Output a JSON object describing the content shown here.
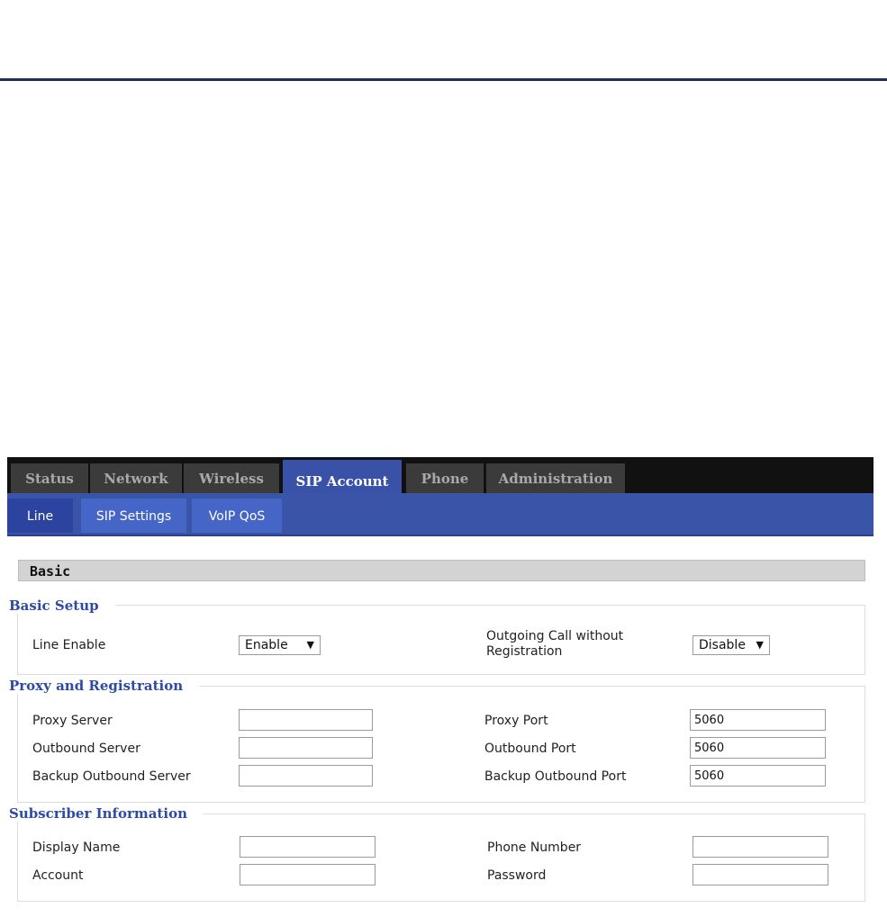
{
  "nav": {
    "tabs": [
      {
        "label": "Status"
      },
      {
        "label": "Network"
      },
      {
        "label": "Wireless"
      },
      {
        "label": "SIP Account"
      },
      {
        "label": "Phone"
      },
      {
        "label": "Administration"
      }
    ],
    "active_tab": "SIP Account"
  },
  "subnav": {
    "tabs": [
      {
        "label": "Line"
      },
      {
        "label": "SIP Settings"
      },
      {
        "label": "VoIP QoS"
      }
    ],
    "active_tab": "Line"
  },
  "section": {
    "title": "Basic"
  },
  "basic_setup": {
    "legend": "Basic Setup",
    "line_enable_label": "Line Enable",
    "line_enable_value": "Enable",
    "outgoing_label_line1": "Outgoing Call without",
    "outgoing_label_line2": "Registration",
    "outgoing_value": "Disable",
    "arrow_icon": "▼"
  },
  "proxy": {
    "legend": "Proxy and Registration",
    "proxy_server_label": "Proxy Server",
    "proxy_server_value": "",
    "outbound_server_label": "Outbound Server",
    "outbound_server_value": "",
    "backup_outbound_server_label": "Backup Outbound Server",
    "backup_outbound_server_value": "",
    "proxy_port_label": "Proxy Port",
    "proxy_port_value": "5060",
    "outbound_port_label": "Outbound Port",
    "outbound_port_value": "5060",
    "backup_outbound_port_label": "Backup Outbound Port",
    "backup_outbound_port_value": "5060"
  },
  "subscriber": {
    "legend": "Subscriber Information",
    "display_name_label": "Display Name",
    "display_name_value": "",
    "account_label": "Account",
    "account_value": "",
    "phone_number_label": "Phone Number",
    "phone_number_value": "",
    "password_label": "Password",
    "password_value": ""
  },
  "colors": {
    "top_bar": "#111111",
    "tab_inactive": "#3b3b3b",
    "tab_active": "#3952a8",
    "sub_bar": "#3a55a8",
    "legend_text": "#2c4aa6",
    "header_rule": "#1f3050"
  }
}
